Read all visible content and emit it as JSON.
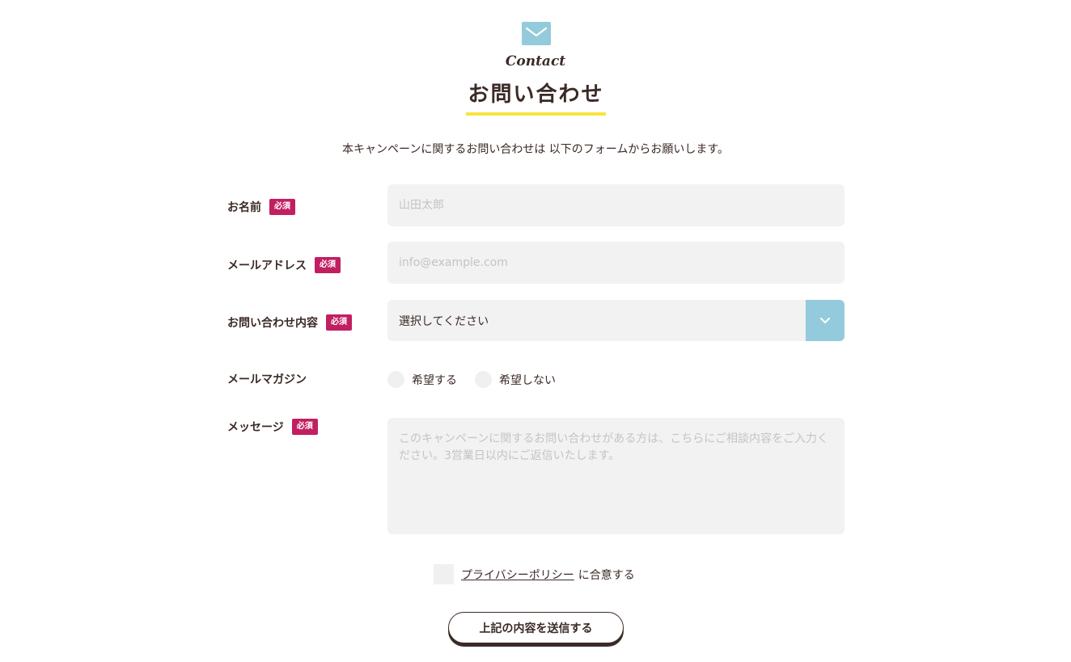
{
  "header": {
    "icon": "mail-icon",
    "title_en": "Contact",
    "title_ja": "お問い合わせ",
    "lead": "本キャンペーンに関するお問い合わせは 以下のフォームからお願いします。"
  },
  "colors": {
    "accent": "#94cbdc",
    "underline": "#f6e43f",
    "required_badge": "#c21f61",
    "text": "#3b2a26",
    "field_bg": "#f2f2f2"
  },
  "form": {
    "required_label": "必須",
    "name": {
      "label": "お名前",
      "placeholder": "山田太郎"
    },
    "email": {
      "label": "メールアドレス",
      "placeholder": "info@example.com"
    },
    "inquiry": {
      "label": "お問い合わせ内容",
      "selected": "選択してください"
    },
    "newsletter": {
      "label": "メールマガジン",
      "options": [
        "希望する",
        "希望しない"
      ]
    },
    "message": {
      "label": "メッセージ",
      "placeholder": "このキャンペーンに関するお問い合わせがある方は、こちらにご相談内容をご入力ください。3営業日以内にご返信いたします。"
    },
    "privacy": {
      "link_text": "プライバシーポリシー",
      "suffix": "に合意する"
    },
    "submit_label": "上記の内容を送信する"
  }
}
